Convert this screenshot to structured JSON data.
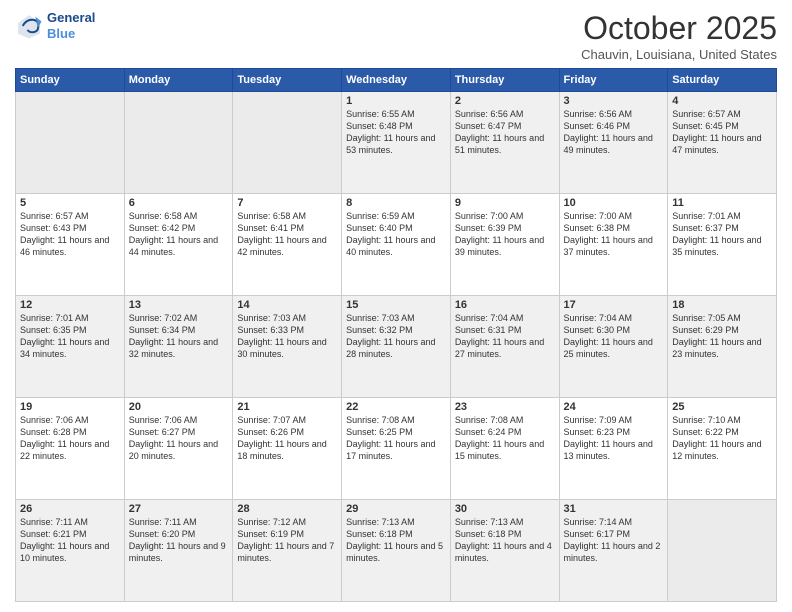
{
  "header": {
    "logo_line1": "General",
    "logo_line2": "Blue",
    "month": "October 2025",
    "location": "Chauvin, Louisiana, United States"
  },
  "weekdays": [
    "Sunday",
    "Monday",
    "Tuesday",
    "Wednesday",
    "Thursday",
    "Friday",
    "Saturday"
  ],
  "weeks": [
    [
      {
        "day": "",
        "empty": true
      },
      {
        "day": "",
        "empty": true
      },
      {
        "day": "",
        "empty": true
      },
      {
        "day": "1",
        "sunrise": "6:55 AM",
        "sunset": "6:48 PM",
        "daylight": "11 hours and 53 minutes."
      },
      {
        "day": "2",
        "sunrise": "6:56 AM",
        "sunset": "6:47 PM",
        "daylight": "11 hours and 51 minutes."
      },
      {
        "day": "3",
        "sunrise": "6:56 AM",
        "sunset": "6:46 PM",
        "daylight": "11 hours and 49 minutes."
      },
      {
        "day": "4",
        "sunrise": "6:57 AM",
        "sunset": "6:45 PM",
        "daylight": "11 hours and 47 minutes."
      }
    ],
    [
      {
        "day": "5",
        "sunrise": "6:57 AM",
        "sunset": "6:43 PM",
        "daylight": "11 hours and 46 minutes."
      },
      {
        "day": "6",
        "sunrise": "6:58 AM",
        "sunset": "6:42 PM",
        "daylight": "11 hours and 44 minutes."
      },
      {
        "day": "7",
        "sunrise": "6:58 AM",
        "sunset": "6:41 PM",
        "daylight": "11 hours and 42 minutes."
      },
      {
        "day": "8",
        "sunrise": "6:59 AM",
        "sunset": "6:40 PM",
        "daylight": "11 hours and 40 minutes."
      },
      {
        "day": "9",
        "sunrise": "7:00 AM",
        "sunset": "6:39 PM",
        "daylight": "11 hours and 39 minutes."
      },
      {
        "day": "10",
        "sunrise": "7:00 AM",
        "sunset": "6:38 PM",
        "daylight": "11 hours and 37 minutes."
      },
      {
        "day": "11",
        "sunrise": "7:01 AM",
        "sunset": "6:37 PM",
        "daylight": "11 hours and 35 minutes."
      }
    ],
    [
      {
        "day": "12",
        "sunrise": "7:01 AM",
        "sunset": "6:35 PM",
        "daylight": "11 hours and 34 minutes."
      },
      {
        "day": "13",
        "sunrise": "7:02 AM",
        "sunset": "6:34 PM",
        "daylight": "11 hours and 32 minutes."
      },
      {
        "day": "14",
        "sunrise": "7:03 AM",
        "sunset": "6:33 PM",
        "daylight": "11 hours and 30 minutes."
      },
      {
        "day": "15",
        "sunrise": "7:03 AM",
        "sunset": "6:32 PM",
        "daylight": "11 hours and 28 minutes."
      },
      {
        "day": "16",
        "sunrise": "7:04 AM",
        "sunset": "6:31 PM",
        "daylight": "11 hours and 27 minutes."
      },
      {
        "day": "17",
        "sunrise": "7:04 AM",
        "sunset": "6:30 PM",
        "daylight": "11 hours and 25 minutes."
      },
      {
        "day": "18",
        "sunrise": "7:05 AM",
        "sunset": "6:29 PM",
        "daylight": "11 hours and 23 minutes."
      }
    ],
    [
      {
        "day": "19",
        "sunrise": "7:06 AM",
        "sunset": "6:28 PM",
        "daylight": "11 hours and 22 minutes."
      },
      {
        "day": "20",
        "sunrise": "7:06 AM",
        "sunset": "6:27 PM",
        "daylight": "11 hours and 20 minutes."
      },
      {
        "day": "21",
        "sunrise": "7:07 AM",
        "sunset": "6:26 PM",
        "daylight": "11 hours and 18 minutes."
      },
      {
        "day": "22",
        "sunrise": "7:08 AM",
        "sunset": "6:25 PM",
        "daylight": "11 hours and 17 minutes."
      },
      {
        "day": "23",
        "sunrise": "7:08 AM",
        "sunset": "6:24 PM",
        "daylight": "11 hours and 15 minutes."
      },
      {
        "day": "24",
        "sunrise": "7:09 AM",
        "sunset": "6:23 PM",
        "daylight": "11 hours and 13 minutes."
      },
      {
        "day": "25",
        "sunrise": "7:10 AM",
        "sunset": "6:22 PM",
        "daylight": "11 hours and 12 minutes."
      }
    ],
    [
      {
        "day": "26",
        "sunrise": "7:11 AM",
        "sunset": "6:21 PM",
        "daylight": "11 hours and 10 minutes."
      },
      {
        "day": "27",
        "sunrise": "7:11 AM",
        "sunset": "6:20 PM",
        "daylight": "11 hours and 9 minutes."
      },
      {
        "day": "28",
        "sunrise": "7:12 AM",
        "sunset": "6:19 PM",
        "daylight": "11 hours and 7 minutes."
      },
      {
        "day": "29",
        "sunrise": "7:13 AM",
        "sunset": "6:18 PM",
        "daylight": "11 hours and 5 minutes."
      },
      {
        "day": "30",
        "sunrise": "7:13 AM",
        "sunset": "6:18 PM",
        "daylight": "11 hours and 4 minutes."
      },
      {
        "day": "31",
        "sunrise": "7:14 AM",
        "sunset": "6:17 PM",
        "daylight": "11 hours and 2 minutes."
      },
      {
        "day": "",
        "empty": true
      }
    ]
  ]
}
